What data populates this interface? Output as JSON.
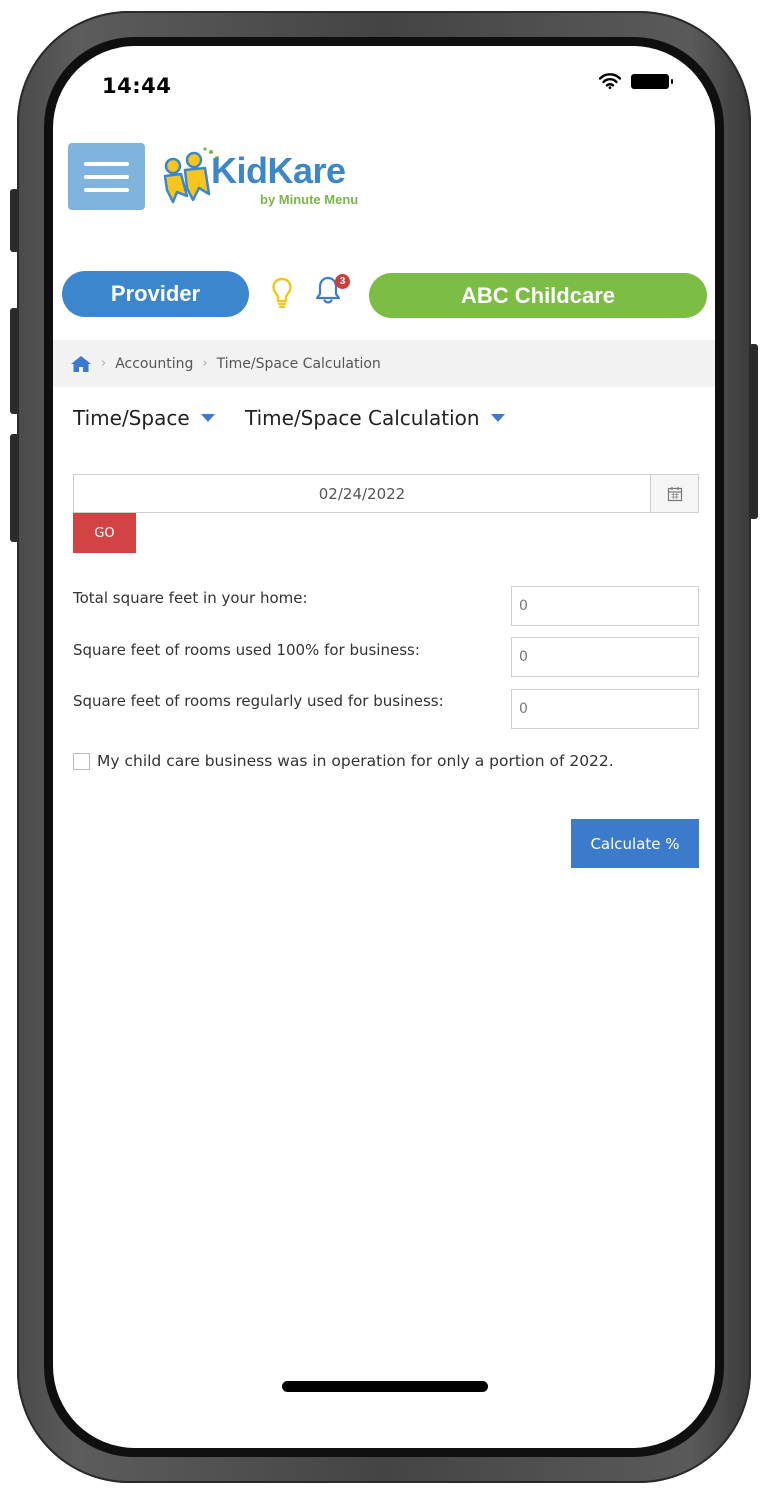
{
  "status_bar": {
    "time": "14:44"
  },
  "header": {
    "menu_icon": "hamburger-icon",
    "logo": {
      "name": "KidKare",
      "subtitle": "by Minute Menu"
    }
  },
  "role_bar": {
    "provider_label": "Provider",
    "notification_count": "3",
    "center_name": "ABC Childcare",
    "colors": {
      "provider": "#3b86cc",
      "center": "#7cbd45",
      "bulb": "#f5c518"
    }
  },
  "breadcrumb": {
    "home_icon": "home-icon",
    "items": [
      "Accounting",
      "Time/Space Calculation"
    ]
  },
  "nav": {
    "menu1": "Time/Space",
    "menu2": "Time/Space Calculation"
  },
  "date_filter": {
    "value": "02/24/2022",
    "calendar_icon": "calendar-icon",
    "go_label": "GO"
  },
  "form": {
    "total_sqft_label": "Total square feet in your home:",
    "total_sqft_value": "0",
    "full_business_label": "Square feet of rooms used 100% for business:",
    "full_business_value": "0",
    "regular_business_label": "Square feet of rooms regularly used for business:",
    "regular_business_value": "0",
    "partial_year_label": "My child care business was in operation for only a portion of 2022.",
    "partial_year_checked": false,
    "calculate_label": "Calculate %"
  }
}
